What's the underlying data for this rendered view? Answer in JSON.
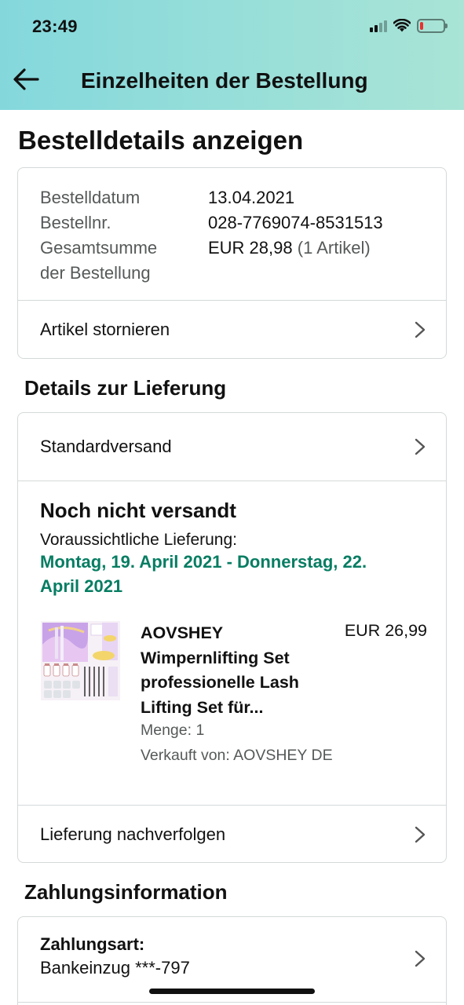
{
  "status_bar": {
    "time": "23:49"
  },
  "header": {
    "title": "Einzelheiten der Bestellung"
  },
  "page_heading": "Bestelldetails anzeigen",
  "order_summary": {
    "date_label": "Bestelldatum",
    "date_value": "13.04.2021",
    "number_label": "Bestellnr.",
    "number_value": "028-7769074-8531513",
    "total_label_line1": "Gesamtsumme",
    "total_label_line2": "der Bestellung",
    "total_value": "EUR 28,98",
    "total_items": "(1 Artikel)",
    "cancel_link": "Artikel stornieren"
  },
  "delivery": {
    "heading": "Details zur Lieferung",
    "shipping_method": "Standardversand",
    "status": "Noch nicht versandt",
    "eta_label": "Voraussichtliche Lieferung:",
    "eta_line1": "Montag, 19. April 2021 - Donnerstag, 22.",
    "eta_line2": "April 2021",
    "product": {
      "title_line1": "AOVSHEY",
      "title_line2": "Wimpernlifting Set",
      "title_line3": "professionelle Lash",
      "title_line4": "Lifting Set für...",
      "price": "EUR 26,99",
      "quantity": "Menge: 1",
      "seller": "Verkauft von: AOVSHEY DE"
    },
    "track_link": "Lieferung nachverfolgen"
  },
  "payment": {
    "heading": "Zahlungsinformation",
    "method_label": "Zahlungsart:",
    "method_value": "Bankeinzug ***-797"
  },
  "colors": {
    "header_gradient_start": "#84d8dc",
    "header_gradient_end": "#a9e4d6",
    "eta_green": "#067d62",
    "border": "#d5d9d9",
    "muted_text": "#565959"
  }
}
